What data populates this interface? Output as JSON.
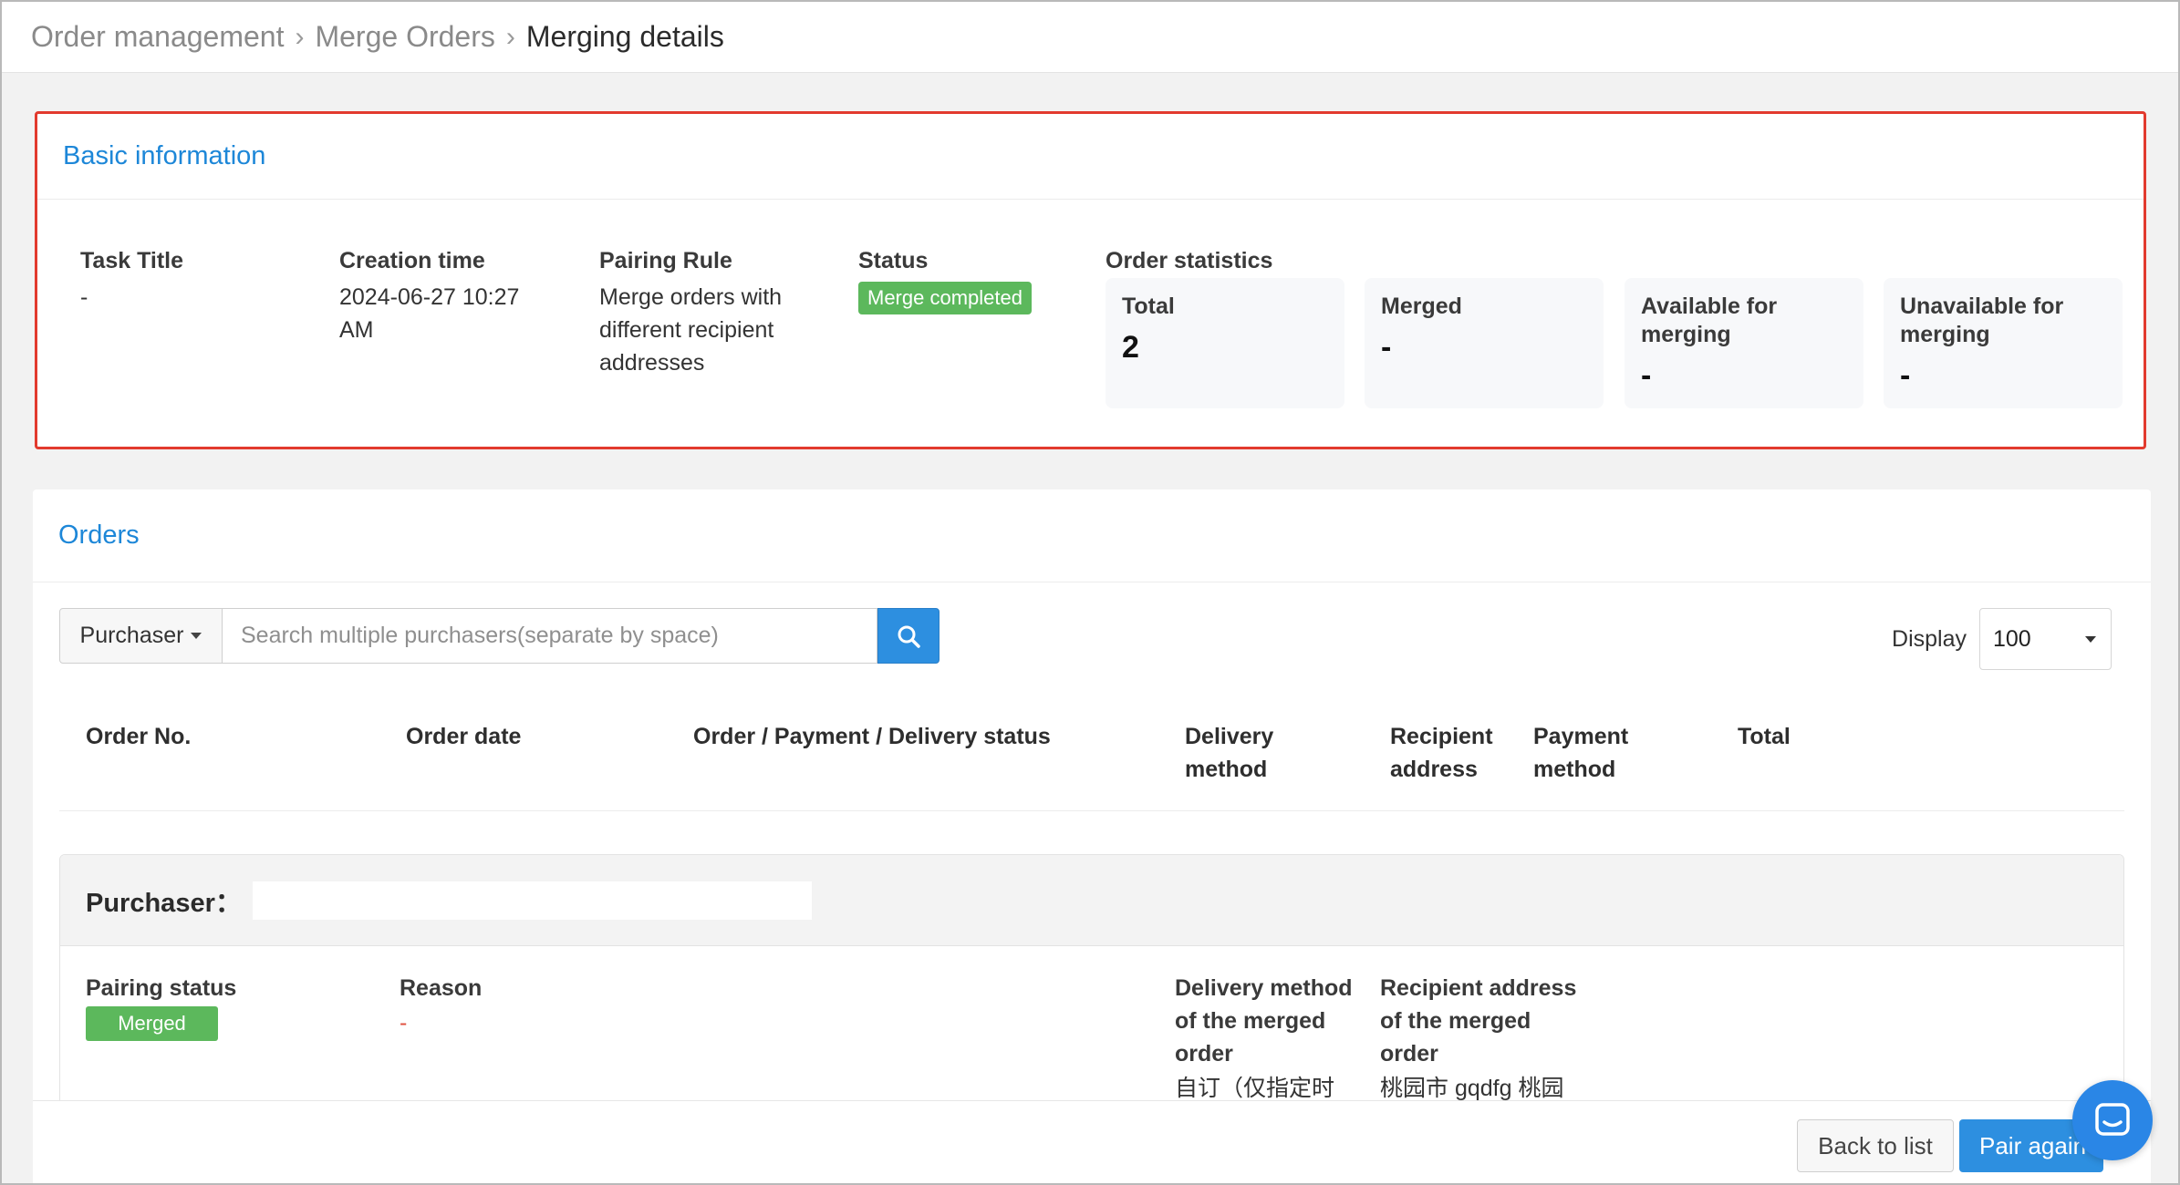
{
  "breadcrumb": {
    "items": [
      "Order management",
      "Merge Orders",
      "Merging details"
    ]
  },
  "basic": {
    "title": "Basic information",
    "task_title_label": "Task Title",
    "task_title_value": "-",
    "creation_time_label": "Creation time",
    "creation_time_value": "2024-06-27 10:27 AM",
    "pairing_rule_label": "Pairing Rule",
    "pairing_rule_value": "Merge orders with different recipient addresses",
    "status_label": "Status",
    "status_value": "Merge completed",
    "order_stats_label": "Order statistics",
    "stats": [
      {
        "label": "Total",
        "value": "2"
      },
      {
        "label": "Merged",
        "value": "-"
      },
      {
        "label": "Available for merging",
        "value": "-"
      },
      {
        "label": "Unavailable for merging",
        "value": "-"
      }
    ]
  },
  "orders": {
    "title": "Orders",
    "filter_dropdown": "Purchaser",
    "search_placeholder": "Search multiple purchasers(separate by space)",
    "display_label": "Display",
    "display_value": "100",
    "columns": [
      "Order No.",
      "Order date",
      "Order / Payment / Delivery status",
      "Delivery method",
      "Recipient address",
      "Payment method",
      "Total"
    ],
    "group": {
      "purchaser_label": "Purchaser：",
      "pairing_status_label": "Pairing status",
      "pairing_status_value": "Merged",
      "reason_label": "Reason",
      "reason_value": "-",
      "delivery_method_merged_label": "Delivery method of the merged order",
      "delivery_method_merged_value": "自订（仅指定时段）",
      "recipient_address_merged_label": "Recipient address of the merged order",
      "recipient_address_merged_value": "桃园市 gqdfg 桃园"
    }
  },
  "footer": {
    "back_label": "Back to list",
    "pair_label": "Pair again"
  },
  "colors": {
    "accent": "#2d8fe0",
    "title_blue": "#1d87d8",
    "success": "#5cb85c",
    "highlight_border": "#e23a2e"
  }
}
